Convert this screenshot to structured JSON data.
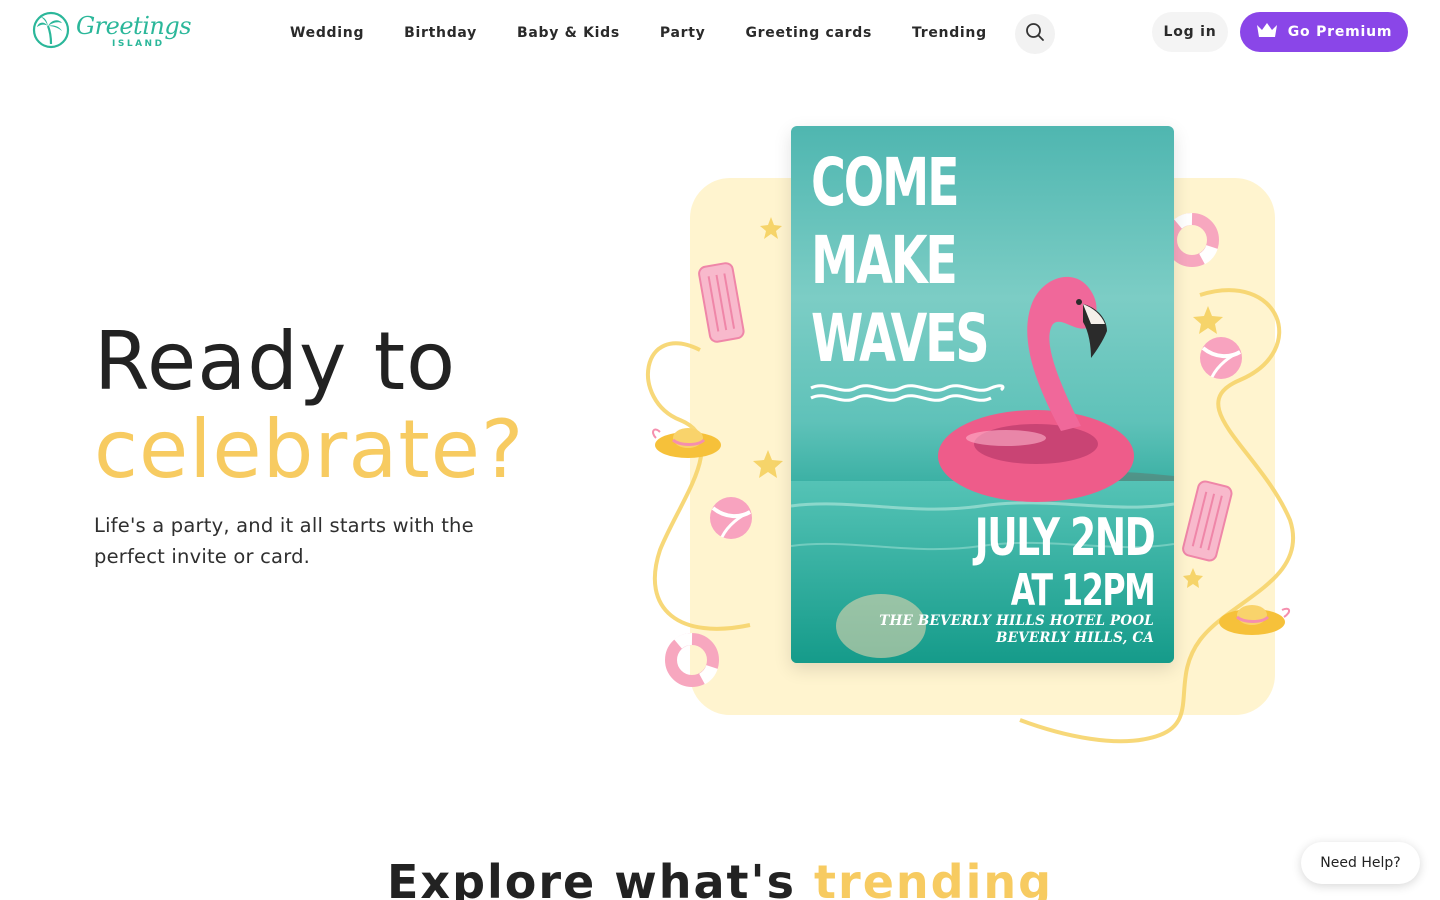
{
  "brand": {
    "name_script": "Greetings",
    "name_sub": "ISLAND",
    "logo_icon": "palm-tree-icon",
    "color": "#2bb79a"
  },
  "nav": {
    "items": [
      {
        "label": "Wedding"
      },
      {
        "label": "Birthday"
      },
      {
        "label": "Baby & Kids"
      },
      {
        "label": "Party"
      },
      {
        "label": "Greeting cards"
      },
      {
        "label": "Trending"
      }
    ],
    "search_icon": "search-icon"
  },
  "account": {
    "login_label": "Log in",
    "premium_label": "Go Premium",
    "premium_icon": "crown-icon",
    "premium_color": "#8a46e8"
  },
  "hero": {
    "title_line1": "Ready to",
    "title_line2": "celebrate?",
    "accent_color": "#f7cb61",
    "subtitle": "Life's a party, and it all starts with the perfect invite or card."
  },
  "invite_card": {
    "headline": [
      "COME",
      "MAKE",
      "WAVES"
    ],
    "date_line": "JULY 2ND",
    "time_line": "AT 12PM",
    "venue_line1": "THE BEVERLY HILLS HOTEL POOL",
    "venue_line2": "BEVERLY HILLS, CA"
  },
  "explore": {
    "text": "Explore what's",
    "accent": "trending"
  },
  "help": {
    "label": "Need Help?"
  }
}
